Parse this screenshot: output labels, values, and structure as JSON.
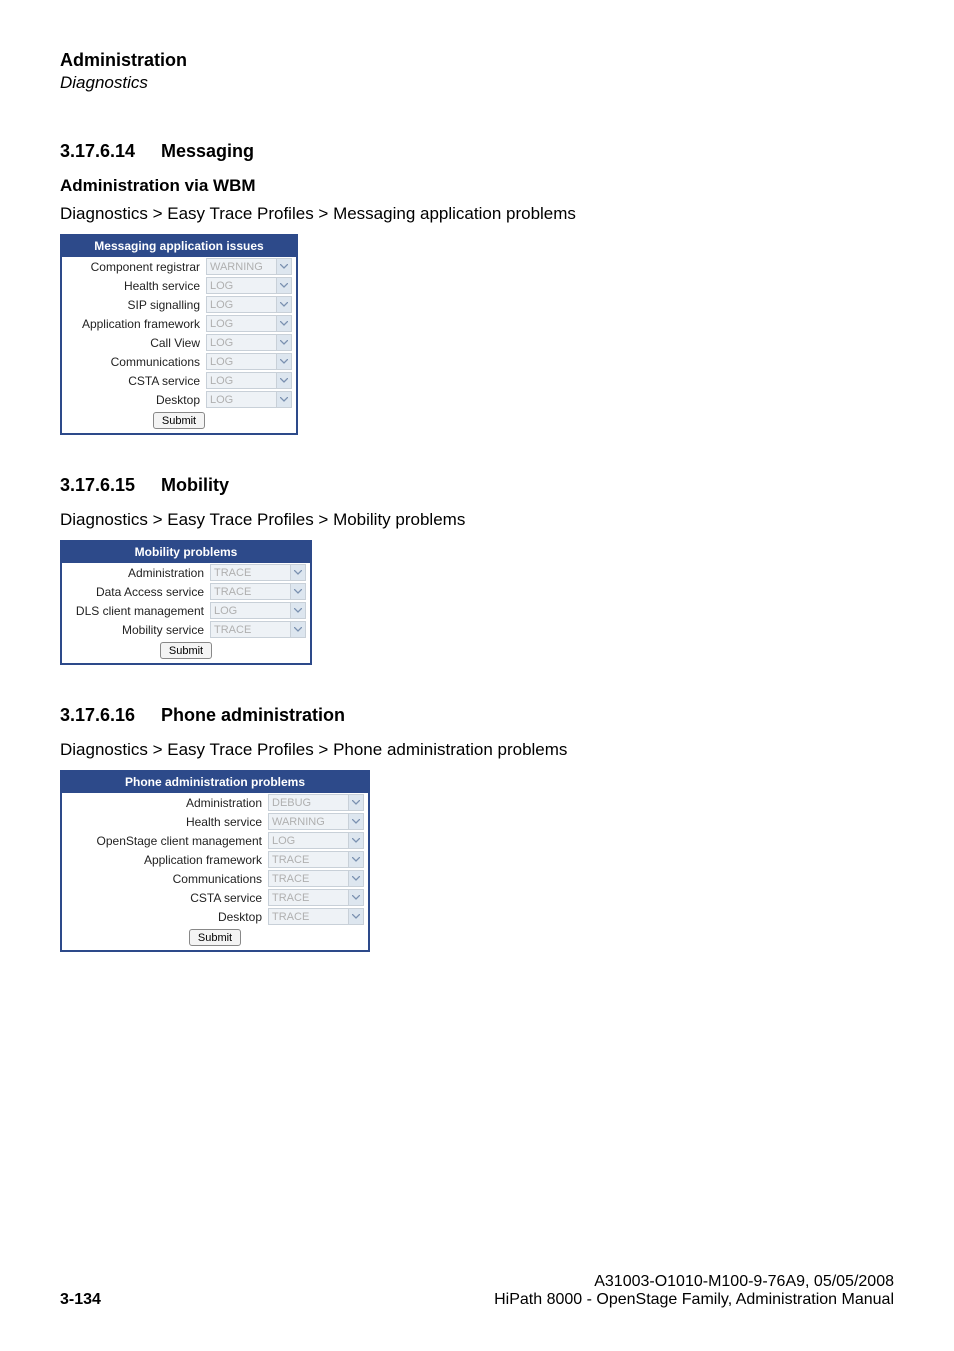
{
  "header": {
    "title": "Administration",
    "subtitle": "Diagnostics"
  },
  "sections": {
    "s1": {
      "num": "3.17.6.14",
      "title": "Messaging",
      "sub": "Administration via WBM",
      "breadcrumb": "Diagnostics > Easy Trace Profiles > Messaging application problems",
      "panel_title": "Messaging application issues",
      "rows": [
        {
          "label": "Component registrar",
          "value": "WARNING"
        },
        {
          "label": "Health service",
          "value": "LOG"
        },
        {
          "label": "SIP signalling",
          "value": "LOG"
        },
        {
          "label": "Application framework",
          "value": "LOG"
        },
        {
          "label": "Call View",
          "value": "LOG"
        },
        {
          "label": "Communications",
          "value": "LOG"
        },
        {
          "label": "CSTA service",
          "value": "LOG"
        },
        {
          "label": "Desktop",
          "value": "LOG"
        }
      ],
      "submit": "Submit"
    },
    "s2": {
      "num": "3.17.6.15",
      "title": "Mobility",
      "breadcrumb": "Diagnostics > Easy Trace Profiles > Mobility problems",
      "panel_title": "Mobility problems",
      "rows": [
        {
          "label": "Administration",
          "value": "TRACE"
        },
        {
          "label": "Data Access service",
          "value": "TRACE"
        },
        {
          "label": "DLS client management",
          "value": "LOG"
        },
        {
          "label": "Mobility service",
          "value": "TRACE"
        }
      ],
      "submit": "Submit"
    },
    "s3": {
      "num": "3.17.6.16",
      "title": "Phone administration",
      "breadcrumb": "Diagnostics > Easy Trace Profiles > Phone administration problems",
      "panel_title": "Phone administration problems",
      "rows": [
        {
          "label": "Administration",
          "value": "DEBUG"
        },
        {
          "label": "Health service",
          "value": "WARNING"
        },
        {
          "label": "OpenStage client management",
          "value": "LOG"
        },
        {
          "label": "Application framework",
          "value": "TRACE"
        },
        {
          "label": "Communications",
          "value": "TRACE"
        },
        {
          "label": "CSTA service",
          "value": "TRACE"
        },
        {
          "label": "Desktop",
          "value": "TRACE"
        }
      ],
      "submit": "Submit"
    }
  },
  "footer": {
    "page": "3-134",
    "line1": "A31003-O1010-M100-9-76A9, 05/05/2008",
    "line2": "HiPath 8000 - OpenStage Family, Administration Manual"
  }
}
